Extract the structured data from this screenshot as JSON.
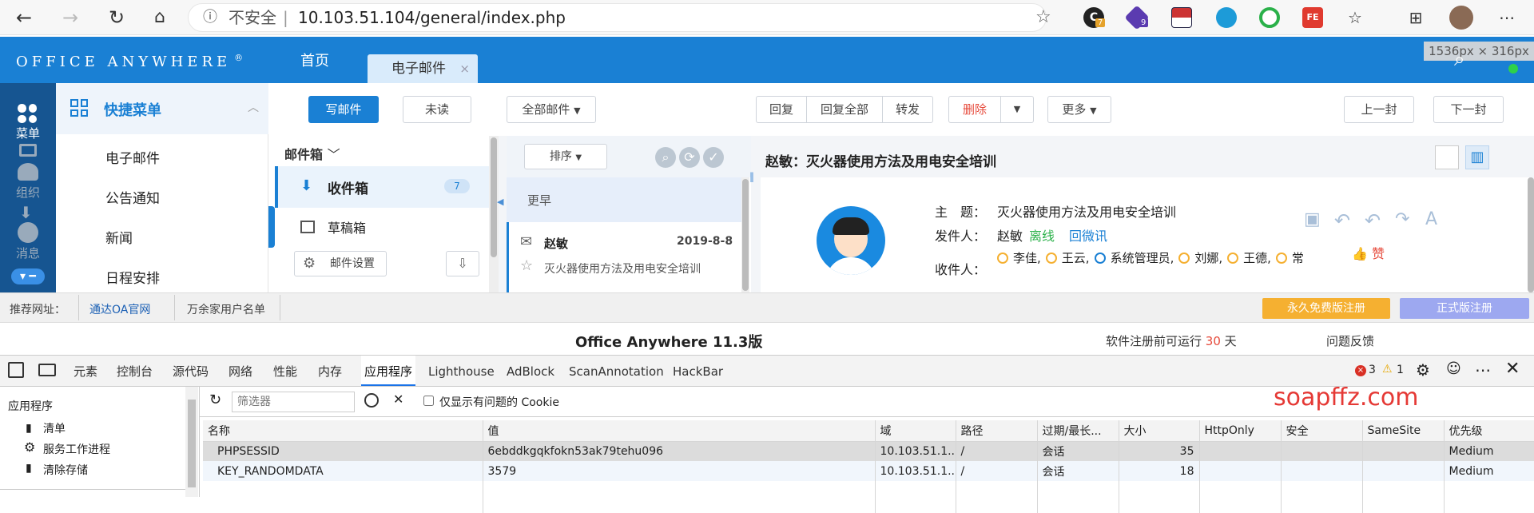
{
  "browser": {
    "security_label": "不安全",
    "url": "10.103.51.104/general/index.php",
    "ext_badges": [
      "7",
      "9"
    ],
    "size_overlay": "1536px × 316px"
  },
  "oa": {
    "logo": "OFFICE ANYWHERE",
    "logo_mark": "®",
    "nav_tabs": [
      "首页",
      "电子邮件"
    ],
    "left_rail": [
      "菜单",
      "组织",
      "消息"
    ],
    "quick_menu_title": "快捷菜单",
    "menu_items": [
      "电子邮件",
      "公告通知",
      "新闻",
      "日程安排"
    ],
    "toolbar": {
      "compose": "写邮件",
      "unread": "未读",
      "all_mail": "全部邮件",
      "reply": "回复",
      "reply_all": "回复全部",
      "forward": "转发",
      "delete": "删除",
      "more": "更多",
      "prev": "上一封",
      "next": "下一封"
    },
    "mailbox": {
      "title": "邮件箱",
      "inbox": "收件箱",
      "inbox_count": "7",
      "drafts": "草稿箱",
      "settings": "邮件设置"
    },
    "list": {
      "sort": "排序",
      "group": "更早",
      "sender": "赵敏",
      "date": "2019-8-8",
      "subject": "灭火器使用方法及用电安全培训"
    },
    "detail": {
      "title": "赵敏：灭火器使用方法及用电安全培训",
      "subject_label": "主　题：",
      "subject": "灭火器使用方法及用电安全培训",
      "from_label": "发件人：",
      "from": "赵敏",
      "offline": "离线",
      "wechat": "回微讯",
      "to_label": "收件人：",
      "recipients": [
        "李佳,",
        "王云,",
        "系统管理员,",
        "刘娜,",
        "王德,",
        "常"
      ],
      "like": "赞"
    },
    "recommend": {
      "label": "推荐网址：",
      "links": [
        "通达OA官网",
        "万余家用户名单"
      ],
      "free_btn": "永久免费版注册",
      "pro_btn": "正式版注册"
    },
    "product": {
      "name": "Office Anywhere 11.3版",
      "reg_prefix": "软件注册前可运行",
      "reg_days": "30",
      "reg_suffix": "天",
      "feedback": "问题反馈"
    }
  },
  "devtools": {
    "tabs": [
      "元素",
      "控制台",
      "源代码",
      "网络",
      "性能",
      "内存",
      "应用程序",
      "Lighthouse",
      "AdBlock",
      "ScanAnnotation",
      "HackBar"
    ],
    "error_count": "3",
    "warn_count": "1",
    "side_title": "应用程序",
    "side_items": [
      "清单",
      "服务工作进程",
      "清除存储"
    ],
    "filter_placeholder": "筛选器",
    "only_issue_cookie": "仅显示有问题的 Cookie",
    "watermark": "soapffz.com",
    "columns": [
      "名称",
      "值",
      "域",
      "路径",
      "过期/最长...",
      "大小",
      "HttpOnly",
      "安全",
      "SameSite",
      "优先级"
    ],
    "rows": [
      [
        "PHPSESSID",
        "6ebddkgqkfokn53ak79tehu096",
        "10.103.51.1...",
        "/",
        "会话",
        "35",
        "",
        "",
        "",
        "Medium"
      ],
      [
        "KEY_RANDOMDATA",
        "3579",
        "10.103.51.1...",
        "/",
        "会话",
        "18",
        "",
        "",
        "",
        "Medium"
      ]
    ]
  },
  "colors": {
    "oa_blue": "#1a80d4",
    "rail": "#165591",
    "accent_red": "#e64a3b",
    "orange": "#f5b031",
    "purple": "#9da8f0"
  }
}
